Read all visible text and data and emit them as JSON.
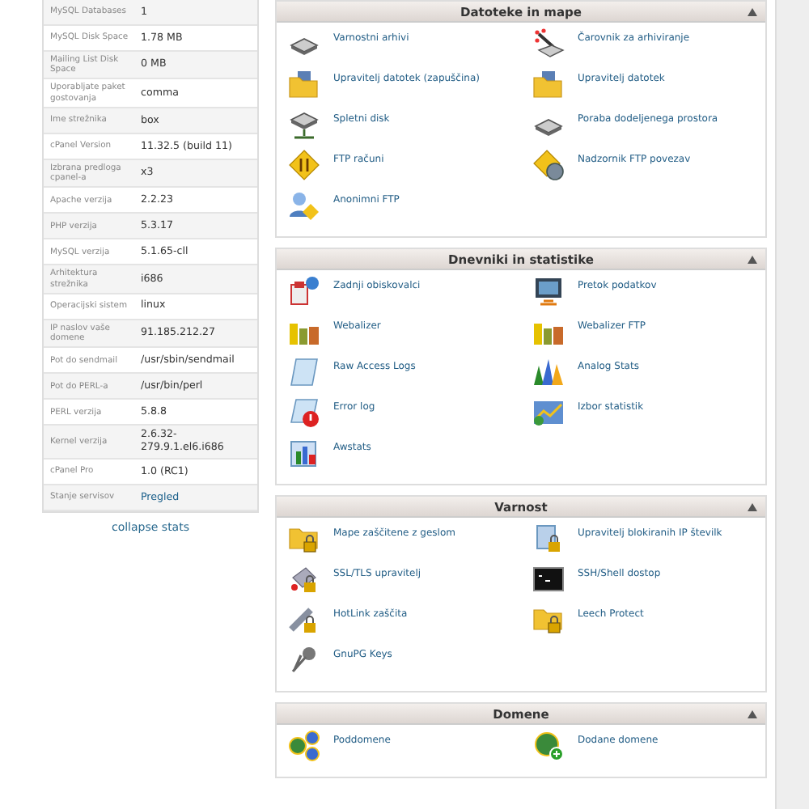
{
  "stats": [
    {
      "label": "MySQL Databases",
      "value": "1"
    },
    {
      "label": "MySQL Disk Space",
      "value": "1.78 MB"
    },
    {
      "label": "Mailing List Disk Space",
      "value": "0 MB"
    },
    {
      "label": "Uporabljate paket gostovanja",
      "value": "comma"
    },
    {
      "label": "Ime strežnika",
      "value": "box"
    },
    {
      "label": "cPanel Version",
      "value": "11.32.5 (build 11)"
    },
    {
      "label": "Izbrana predloga cpanel-a",
      "value": "x3"
    },
    {
      "label": "Apache verzija",
      "value": "2.2.23"
    },
    {
      "label": "PHP verzija",
      "value": "5.3.17"
    },
    {
      "label": "MySQL verzija",
      "value": "5.1.65-cll"
    },
    {
      "label": "Arhitektura strežnika",
      "value": "i686"
    },
    {
      "label": "Operacijski sistem",
      "value": "linux"
    },
    {
      "label": "IP naslov vaše domene",
      "value": "91.185.212.27"
    },
    {
      "label": "Pot do sendmail",
      "value": "/usr/sbin/sendmail"
    },
    {
      "label": "Pot do PERL-a",
      "value": "/usr/bin/perl"
    },
    {
      "label": "PERL verzija",
      "value": "5.8.8"
    },
    {
      "label": "Kernel verzija",
      "value": "2.6.32-279.9.1.el6.i686"
    },
    {
      "label": "cPanel Pro",
      "value": "1.0 (RC1)"
    },
    {
      "label": "Stanje servisov",
      "value": "Pregled",
      "link": true
    }
  ],
  "collapse_link": "collapse stats",
  "sections": [
    {
      "title": "Datoteke in mape",
      "expanded": true,
      "items": [
        "Varnostni arhivi",
        "Čarovnik za arhiviranje",
        "Upravitelj datotek (zapuščina)",
        "Upravitelj datotek",
        "Spletni disk",
        "Poraba dodeljenega prostora",
        "FTP računi",
        "Nadzornik FTP povezav",
        "Anonimni FTP"
      ]
    },
    {
      "title": "Dnevniki in statistike",
      "expanded": true,
      "items": [
        "Zadnji obiskovalci",
        "Pretok podatkov",
        "Webalizer",
        "Webalizer FTP",
        "Raw Access Logs",
        "Analog Stats",
        "Error log",
        "Izbor statistik",
        "Awstats"
      ]
    },
    {
      "title": "Varnost",
      "expanded": true,
      "items": [
        "Mape zaščitene z geslom",
        "Upravitelj blokiranih IP številk",
        "SSL/TLS upravitelj",
        "SSH/Shell dostop",
        "HotLink zaščita",
        "Leech Protect",
        "GnuPG Keys"
      ]
    },
    {
      "title": "Domene",
      "expanded": true,
      "items": [
        "Poddomene",
        "Dodane domene"
      ]
    }
  ]
}
